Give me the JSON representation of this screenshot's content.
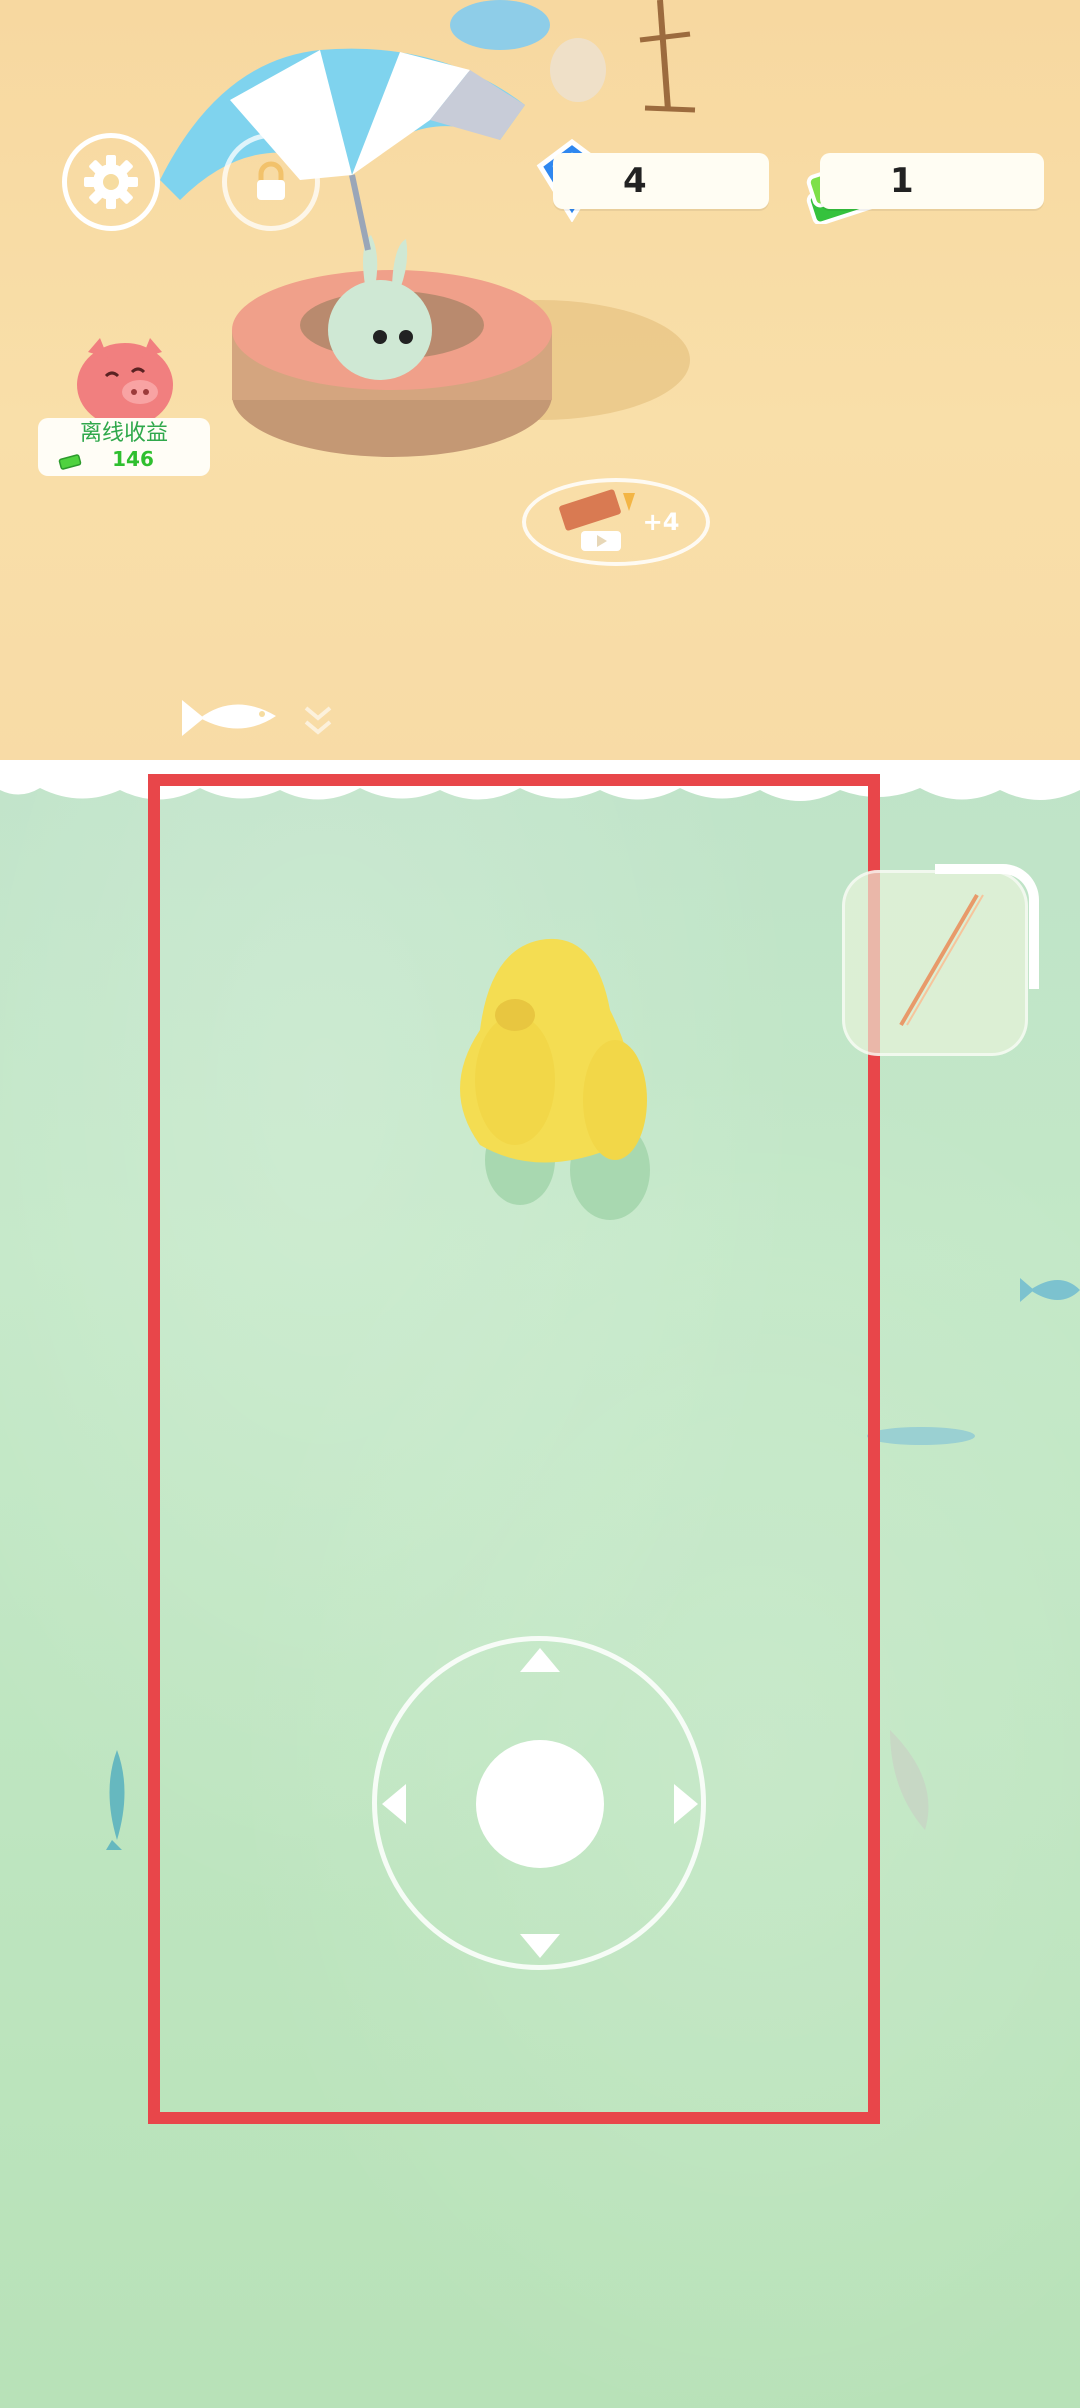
{
  "hud": {
    "settings_icon": "gear-icon",
    "locked_slot_icon": "lock-icon",
    "gems": {
      "icon": "gem-icon",
      "value": "4"
    },
    "cash": {
      "icon": "cash-icon",
      "value": "1"
    }
  },
  "offline_earnings": {
    "title": "离线收益",
    "value": "146",
    "icon": "piggy-bank-icon"
  },
  "reward": {
    "label": "+4",
    "icon": "video-ad-icon"
  },
  "fish_hint_icon": "fish-icon",
  "rod_button_icon": "fishing-rod-icon",
  "joystick": {
    "arrows": [
      "up",
      "down",
      "left",
      "right"
    ]
  },
  "colors": {
    "sand": "#f7d8a0",
    "sea": "#c0e6c6",
    "selection_border": "#e8464a",
    "player": "#f4dd52",
    "offline_text": "#2fa84b"
  }
}
